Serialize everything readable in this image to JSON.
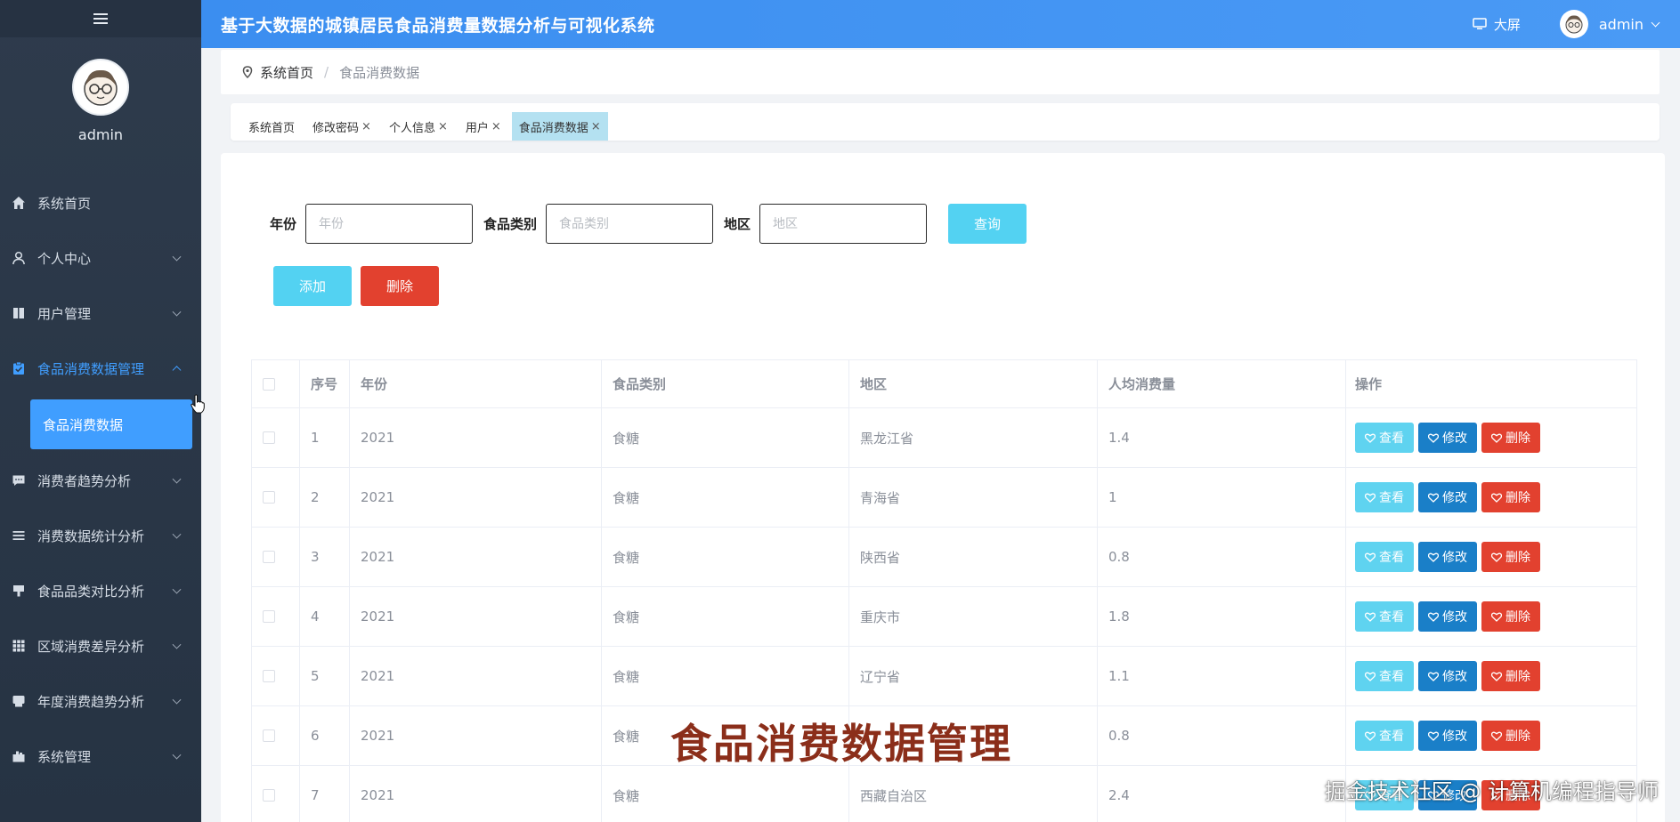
{
  "app": {
    "title": "基于大数据的城镇居民食品消费量数据分析与可视化系统",
    "bigscreen_label": "大屏",
    "user_name": "admin"
  },
  "sidebar": {
    "user_name": "admin",
    "items": [
      {
        "label": "系统首页",
        "icon": "home-icon",
        "expandable": false
      },
      {
        "label": "个人中心",
        "icon": "user-icon",
        "expandable": true
      },
      {
        "label": "用户管理",
        "icon": "book-icon",
        "expandable": true
      },
      {
        "label": "食品消费数据管理",
        "icon": "clipboard-check-icon",
        "expandable": true,
        "active": true
      },
      {
        "label": "消费者趋势分析",
        "icon": "chat-icon",
        "expandable": true
      },
      {
        "label": "消费数据统计分析",
        "icon": "list-icon",
        "expandable": true
      },
      {
        "label": "食品品类对比分析",
        "icon": "stamp-icon",
        "expandable": true
      },
      {
        "label": "区域消费差异分析",
        "icon": "grid-icon",
        "expandable": true
      },
      {
        "label": "年度消费趋势分析",
        "icon": "printer-icon",
        "expandable": true
      },
      {
        "label": "系统管理",
        "icon": "briefcase-icon",
        "expandable": true
      }
    ],
    "sub_item": "食品消费数据"
  },
  "breadcrumb": {
    "home": "系统首页",
    "separator": "/",
    "current": "食品消费数据"
  },
  "tabs": [
    {
      "label": "系统首页",
      "closable": false
    },
    {
      "label": "修改密码",
      "closable": true
    },
    {
      "label": "个人信息",
      "closable": true
    },
    {
      "label": "用户",
      "closable": true
    },
    {
      "label": "食品消费数据",
      "closable": true,
      "active": true
    }
  ],
  "search": {
    "year_label": "年份",
    "year_placeholder": "年份",
    "category_label": "食品类别",
    "category_placeholder": "食品类别",
    "region_label": "地区",
    "region_placeholder": "地区",
    "query_button": "查询",
    "add_button": "添加",
    "delete_button": "删除"
  },
  "table": {
    "headers": [
      "序号",
      "年份",
      "食品类别",
      "地区",
      "人均消费量",
      "操作"
    ],
    "actions": {
      "view": "查看",
      "edit": "修改",
      "delete": "删除"
    },
    "rows": [
      {
        "no": "1",
        "year": "2021",
        "category": "食糖",
        "region": "黑龙江省",
        "amount": "1.4"
      },
      {
        "no": "2",
        "year": "2021",
        "category": "食糖",
        "region": "青海省",
        "amount": "1"
      },
      {
        "no": "3",
        "year": "2021",
        "category": "食糖",
        "region": "陕西省",
        "amount": "0.8"
      },
      {
        "no": "4",
        "year": "2021",
        "category": "食糖",
        "region": "重庆市",
        "amount": "1.8"
      },
      {
        "no": "5",
        "year": "2021",
        "category": "食糖",
        "region": "辽宁省",
        "amount": "1.1"
      },
      {
        "no": "6",
        "year": "2021",
        "category": "食糖",
        "region": "",
        "amount": "0.8"
      },
      {
        "no": "7",
        "year": "2021",
        "category": "食糖",
        "region": "西藏自治区",
        "amount": "2.4"
      }
    ]
  },
  "overlay": {
    "caption": "食品消费数据管理",
    "watermark": "掘金技术社区 @ 计算机编程指导师"
  },
  "colors": {
    "header": "#3b8ef0",
    "sidebar": "#2e3b4c",
    "active": "#409eff",
    "query": "#53d2f2",
    "delete": "#e2412f",
    "edit": "#1a7fc8"
  }
}
